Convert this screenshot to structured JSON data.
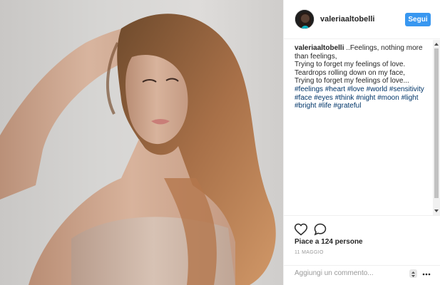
{
  "post": {
    "username": "valeriaaltobelli",
    "follow_label": "Segui",
    "caption_author": "valeriaaltobelli",
    "caption_lines": [
      "..Feelings, nothing more than feelings,",
      "Trying to forget my feelings of love.",
      "Teardrops rolling down on my face,",
      "Trying to forget my feelings of love..."
    ],
    "hashtags": [
      "#feelings",
      "#heart",
      "#love",
      "#world",
      "#sensitivity",
      "#face",
      "#eyes",
      "#think",
      "#night",
      "#moon",
      "#light",
      "#bright",
      "#life",
      "#grateful"
    ],
    "likes_text": "Piace a 124 persone",
    "date_text": "11 MAGGIO",
    "comment_placeholder": "Aggiungi un commento..."
  },
  "icons": {
    "like": "heart-outline-icon",
    "comment": "speech-bubble-icon",
    "more": "ellipsis-icon"
  },
  "colors": {
    "accent": "#3897f0",
    "hashtag": "#003569",
    "muted": "#999999"
  }
}
